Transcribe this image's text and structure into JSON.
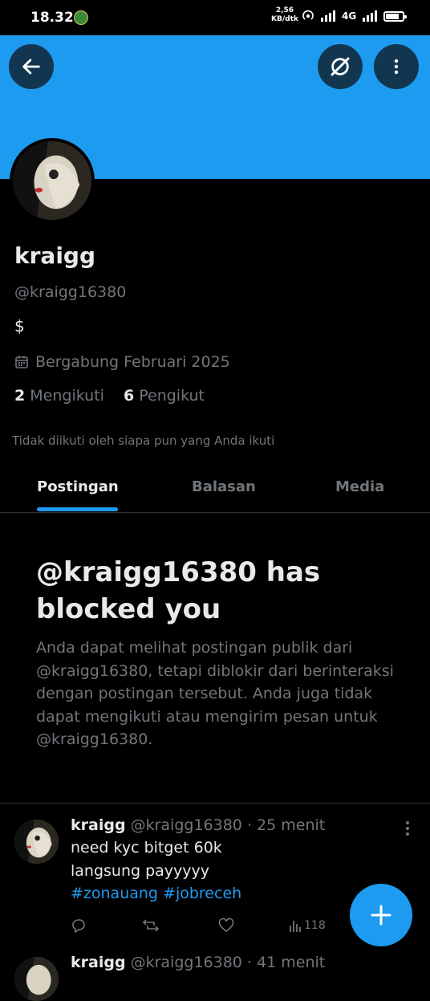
{
  "status_bar": {
    "time": "18.32",
    "speed_value": "2,56",
    "speed_unit": "KB/dtk",
    "network": "4G",
    "battery_level": 0.7
  },
  "header": {
    "banner_color": "#1d9bf0",
    "back_icon": "arrow-left-icon",
    "grok_icon": "grok-icon",
    "more_icon": "more-vertical-icon"
  },
  "profile": {
    "display_name": "kraigg",
    "handle": "@kraigg16380",
    "bio": "$",
    "joined": "Bergabung Februari 2025",
    "following_count": "2",
    "following_label": "Mengikuti",
    "followers_count": "6",
    "followers_label": "Pengikut",
    "not_followed_note": "Tidak diikuti oleh siapa pun yang Anda ikuti"
  },
  "tabs": [
    {
      "label": "Postingan",
      "active": true
    },
    {
      "label": "Balasan",
      "active": false
    },
    {
      "label": "Media",
      "active": false
    }
  ],
  "blocked": {
    "title": "@kraigg16380 has blocked you",
    "description": "Anda dapat melihat postingan publik dari @kraigg16380, tetapi diblokir dari berinteraksi dengan postingan tersebut. Anda juga tidak dapat mengikuti atau mengirim pesan untuk @kraigg16380."
  },
  "posts": [
    {
      "author_name": "kraigg",
      "author_handle": "@kraigg16380",
      "time": "· 25 menit",
      "lines": [
        "need kyc bitget 60k",
        "langsung payyyyy"
      ],
      "hashtags": "#zonauang #jobreceh",
      "views": "118"
    },
    {
      "author_name": "kraigg",
      "author_handle": "@kraigg16380",
      "time": "· 41 menit"
    }
  ],
  "colors": {
    "accent": "#1d9bf0",
    "background": "#000000",
    "text_primary": "#e7e9ea",
    "text_secondary": "#71767b",
    "border": "#2f3336"
  }
}
